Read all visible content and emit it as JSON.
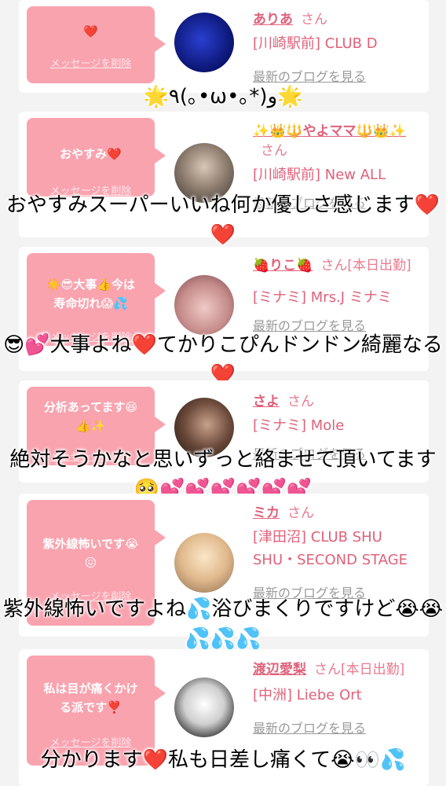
{
  "delete_label": "メッセージを削除",
  "blog_label": "最新のブログを見る",
  "san_label": "さん",
  "colors": {
    "bubble": "#f9a3af",
    "name": "#e0617a",
    "background": "#f3f3f3"
  },
  "cards": [
    {
      "message": "❤️",
      "name": "ありあ",
      "san": "さん",
      "shop": "[川崎駅前] CLUB D",
      "avatar": "avatar-blue"
    },
    {
      "message": "おやすみ❤️",
      "name": "✨👑🔱やよママ🔱👑✨",
      "san": "さん",
      "shop": "[川崎駅前] New ALL",
      "avatar": "avatar-woman"
    },
    {
      "message": "☀️😎大事👍今は\n寿命切れ😱💦",
      "name": "🍓りこ🍓",
      "san": "さん[本日出勤]",
      "shop": "[ミナミ] Mrs.J ミナミ",
      "avatar": "avatar-pink"
    },
    {
      "message": "分析あってます😆\n👍✨",
      "name": "さよ",
      "san": "さん",
      "shop": "[ミナミ] Mole",
      "avatar": "avatar-dark"
    },
    {
      "message": "紫外線怖いです😭\n😖",
      "name": "ミカ",
      "san": "さん",
      "shop": "[津田沼] CLUB SHU SHU・SECOND STAGE",
      "avatar": "avatar-blonde"
    },
    {
      "message": "私は目が痛くかけ\nる派です❣️",
      "name": "渡辺愛梨",
      "san": "さん[本日出勤]",
      "shop": "[中洲] Liebe Ort",
      "avatar": "avatar-bw"
    }
  ],
  "overlays": [
    "🌟٩(｡•ω•｡*)و🌟",
    "おやすみスーパーいいね何か優しさ感じます❤️❤️",
    "😎💕大事よね❤️てかりこぴんドンドン綺麗なる❤️",
    "絶対そうかなと思いずっと絡ませて頂いてます🥺💕💕💕💕💕💕",
    "紫外線怖いですよね💦浴びまくりですけど😭😭💦💦💦",
    "分かります❤️私も日差し痛くて😭👀💦"
  ]
}
